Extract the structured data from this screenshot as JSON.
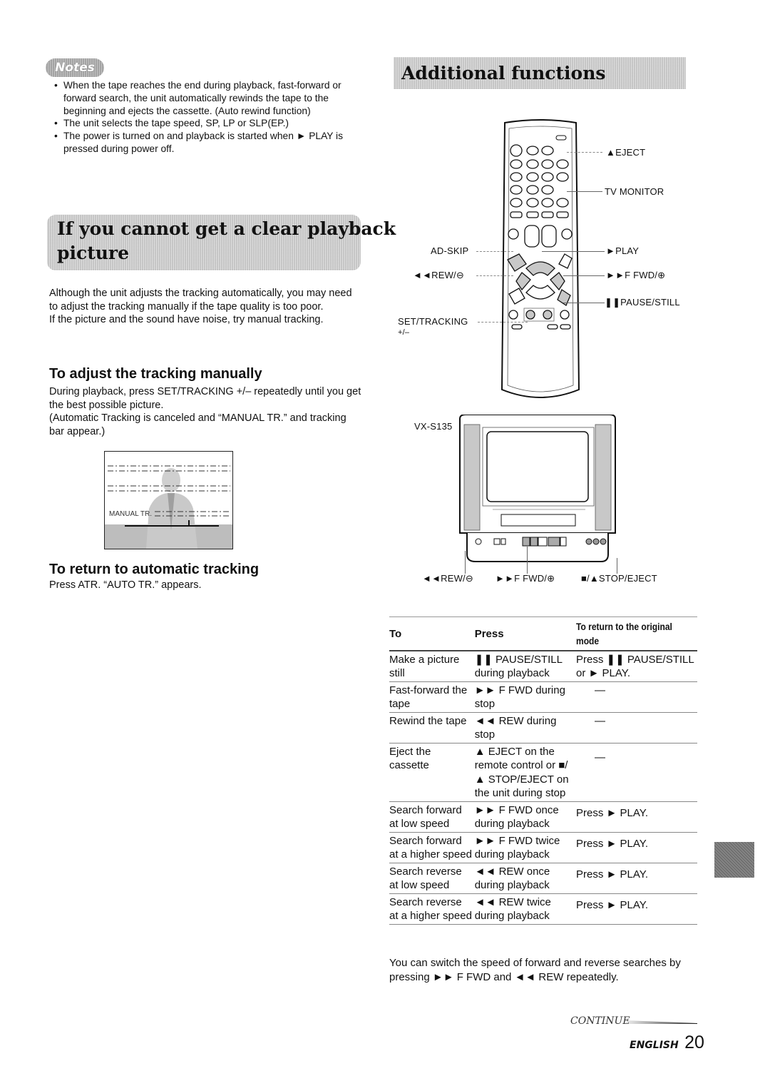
{
  "notes": {
    "badge": "Notes",
    "items": [
      "When the tape reaches the end during playback, fast-forward or forward search, the unit automatically rewinds the tape to the beginning and ejects the cassette. (Auto rewind function)",
      "The unit selects the tape speed, SP, LP or SLP(EP.)",
      "The power is turned on and playback is started when ► PLAY is pressed during power off."
    ]
  },
  "clear_playback": {
    "heading_line1": "If you cannot get a clear playback",
    "heading_line2": "picture",
    "intro": "Although the unit adjusts the tracking automatically, you may need to adjust the tracking manually if the tape quality is too poor.",
    "intro2": "If the picture and the sound have noise, try manual tracking."
  },
  "manual_tracking": {
    "heading": "To adjust the tracking manually",
    "text1": "During playback, press SET/TRACKING +/– repeatedly until you get the best possible picture.",
    "text2": "(Automatic Tracking is canceled and “MANUAL TR.” and tracking bar appear.)",
    "screen_label": "MANUAL TR."
  },
  "auto_tracking": {
    "heading": "To return to automatic tracking",
    "text": "Press ATR.  “AUTO TR.” appears."
  },
  "additional": {
    "heading": "Additional functions",
    "remote_labels": {
      "eject": "▲EJECT",
      "tv_monitor": "TV MONITOR",
      "ad_skip": "AD-SKIP",
      "play": "►PLAY",
      "rew": "◄◄REW/⊖",
      "ffwd": "►►F FWD/⊕",
      "pause": "❚❚PAUSE/STILL",
      "set_tracking": "SET/TRACKING",
      "set_tracking_sub": "+/–"
    },
    "unit_model": "VX-S135",
    "unit_labels": {
      "rew": "◄◄REW/⊖",
      "ffwd": "►►F FWD/⊕",
      "stop_eject": "■/▲STOP/EJECT"
    }
  },
  "table": {
    "headers": [
      "To",
      "Press",
      "To return to the original mode"
    ],
    "rows": [
      {
        "to": "Make a picture still",
        "press": "❚❚ PAUSE/STILL during playback",
        "ret": "Press ❚❚ PAUSE/STILL or ► PLAY."
      },
      {
        "to": "Fast-forward the tape",
        "press": "►► F FWD during stop",
        "ret": "—"
      },
      {
        "to": "Rewind the tape",
        "press": "◄◄ REW during stop",
        "ret": "—"
      },
      {
        "to": "Eject the cassette",
        "press": "▲ EJECT on the remote control or ■/▲ STOP/EJECT on the unit during stop",
        "ret": "—"
      },
      {
        "to": "Search forward at low speed",
        "press": "►► F FWD once during playback",
        "ret": "Press ► PLAY."
      },
      {
        "to": "Search forward at a higher speed",
        "press": "►► F FWD twice during playback",
        "ret": "Press ► PLAY."
      },
      {
        "to": "Search reverse at low speed",
        "press": "◄◄ REW once during playback",
        "ret": "Press ► PLAY."
      },
      {
        "to": "Search reverse at a higher speed",
        "press": "◄◄ REW twice during playback",
        "ret": "Press ► PLAY."
      }
    ],
    "footnote": "You can switch the speed of forward and reverse searches by pressing ►► F FWD and ◄◄ REW repeatedly."
  },
  "footer": {
    "continue": "CONTINUE",
    "language": "ENGLISH",
    "page_number": "20"
  }
}
